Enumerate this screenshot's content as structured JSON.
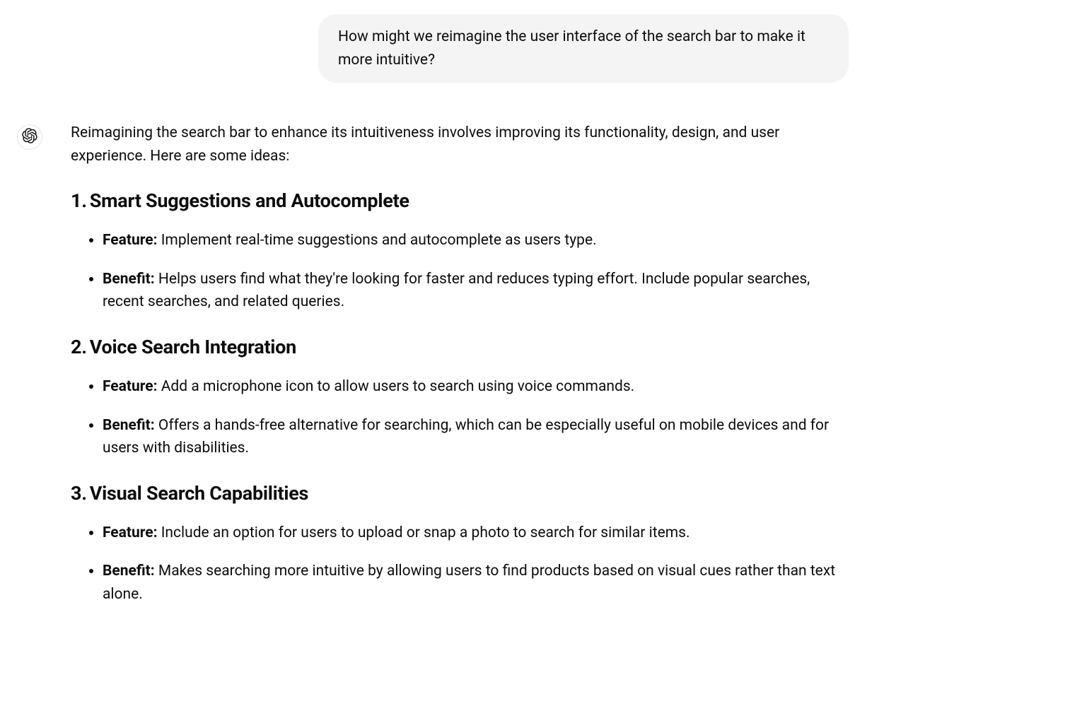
{
  "user_message": "How might we reimagine the user interface of the search bar to make it more intuitive?",
  "assistant": {
    "intro": "Reimagining the search bar to enhance its intuitiveness involves improving its functionality, design, and user experience. Here are some ideas:",
    "sections": [
      {
        "number": "1.",
        "title": "Smart Suggestions and Autocomplete",
        "feature_label": "Feature:",
        "feature_text": " Implement real-time suggestions and autocomplete as users type.",
        "benefit_label": "Benefit:",
        "benefit_text": " Helps users find what they're looking for faster and reduces typing effort. Include popular searches, recent searches, and related queries."
      },
      {
        "number": "2.",
        "title": "Voice Search Integration",
        "feature_label": "Feature:",
        "feature_text": " Add a microphone icon to allow users to search using voice commands.",
        "benefit_label": "Benefit:",
        "benefit_text": " Offers a hands-free alternative for searching, which can be especially useful on mobile devices and for users with disabilities."
      },
      {
        "number": "3.",
        "title": "Visual Search Capabilities",
        "feature_label": "Feature:",
        "feature_text": " Include an option for users to upload or snap a photo to search for similar items.",
        "benefit_label": "Benefit:",
        "benefit_text": " Makes searching more intuitive by allowing users to find products based on visual cues rather than text alone."
      }
    ]
  }
}
